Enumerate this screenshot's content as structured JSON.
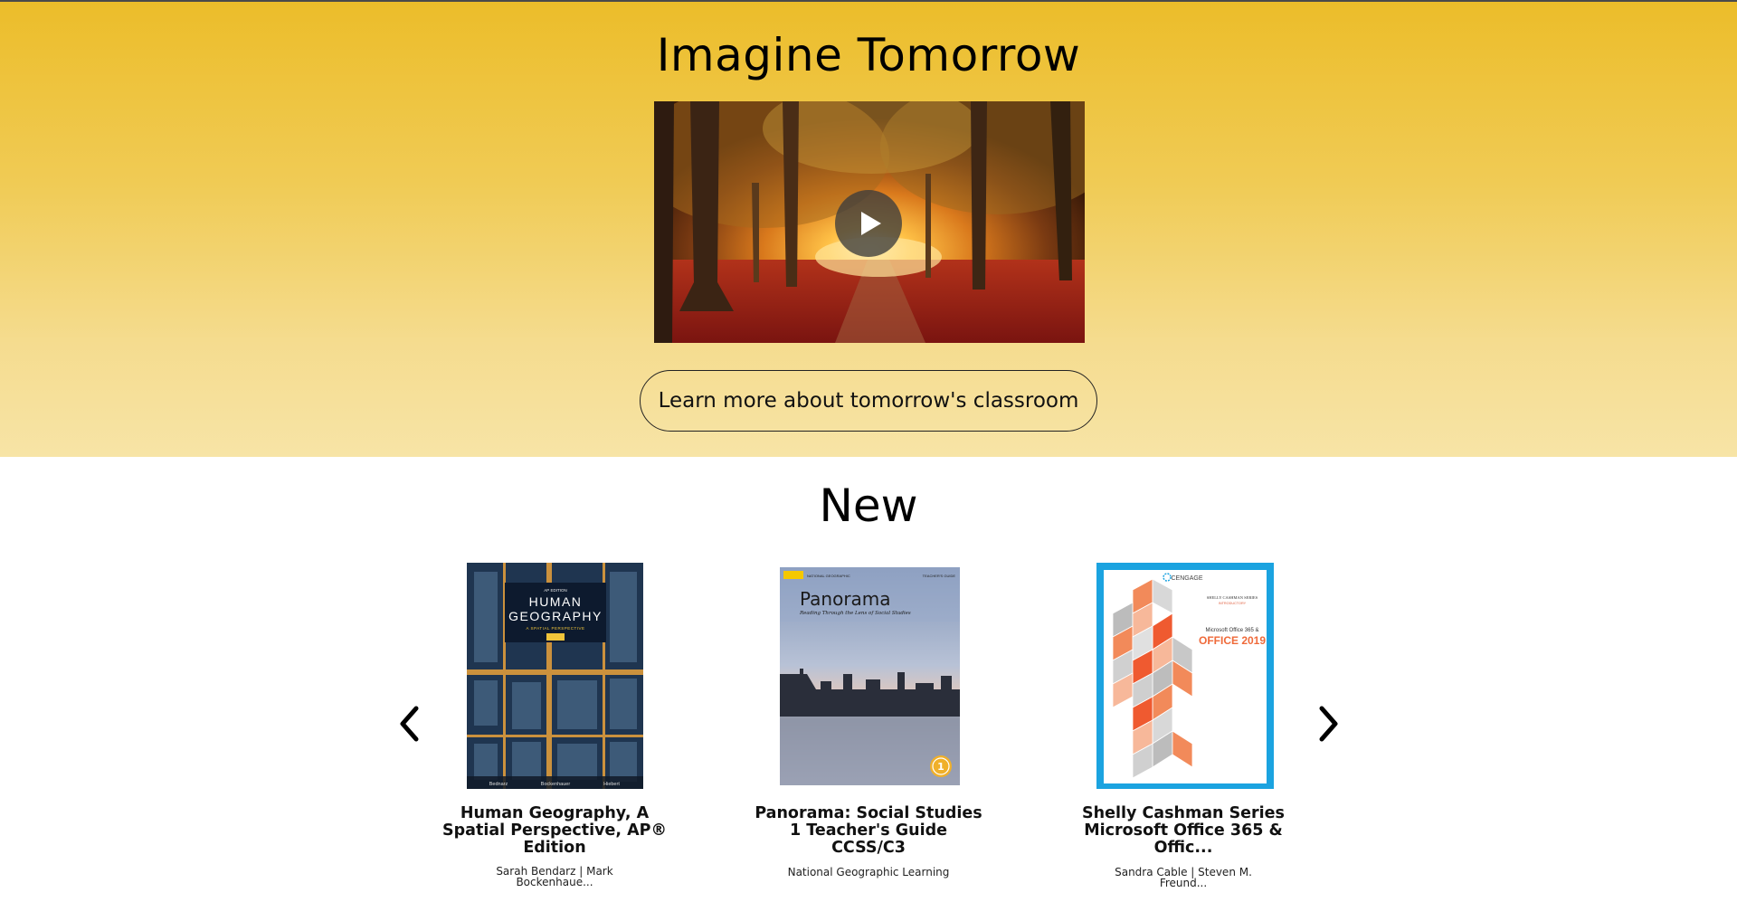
{
  "hero": {
    "title": "Imagine Tomorrow",
    "video": {
      "play_icon": "play-icon"
    },
    "cta_label": "Learn more about tomorrow's classroom",
    "colors": {
      "gradient_top": "#ecbd2a",
      "gradient_bottom": "#f7e4a6"
    }
  },
  "new_section": {
    "title": "New",
    "prev_icon": "chevron-left-icon",
    "next_icon": "chevron-right-icon",
    "books": [
      {
        "title": "Human Geography, A Spatial Perspective, AP® Edition",
        "authors": "Sarah Bendarz | Mark Bockenhaue...",
        "cover": {
          "edition": "AP EDITION",
          "line1": "HUMAN",
          "line2": "GEOGRAPHY",
          "subtitle": "A SPATIAL PERSPECTIVE",
          "authors": [
            "Bednarz",
            "Bockenhauer",
            "Hiebert"
          ]
        }
      },
      {
        "title": "Panorama: Social Studies 1 Teacher's Guide CCSS/C3",
        "authors": "National Geographic Learning",
        "cover": {
          "brand": "NATIONAL GEOGRAPHIC",
          "tag": "TEACHER'S GUIDE",
          "title": "Panorama",
          "subtitle": "Reading Through the Lens of Social Studies",
          "badge": "1"
        }
      },
      {
        "title": "Shelly Cashman Series Microsoft Office 365 & Offic...",
        "authors": "Sandra Cable | Steven M. Freund...",
        "cover": {
          "brand": "CENGAGE",
          "series": "SHELLY CASHMAN SERIES",
          "level": "INTRODUCTORY",
          "line1": "Microsoft Office 365 &",
          "line2": "OFFICE 2019"
        }
      }
    ]
  }
}
